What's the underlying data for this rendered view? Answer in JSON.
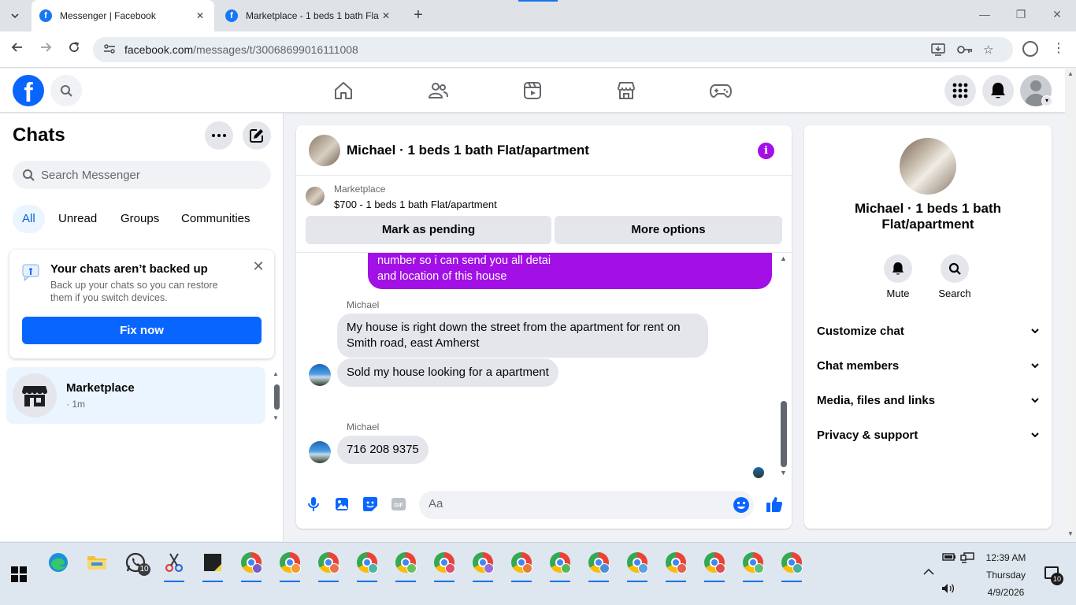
{
  "browser": {
    "tabs": [
      {
        "title": "Messenger | Facebook",
        "favicon": "facebook-icon",
        "active": true
      },
      {
        "title": "Marketplace - 1 beds 1 bath Fla",
        "favicon": "facebook-icon",
        "active": false
      }
    ],
    "url_host": "facebook.com",
    "url_path": "/messages/t/30068699016111008"
  },
  "header": {
    "nav": [
      "home-icon",
      "friends-icon",
      "video-icon",
      "marketplace-icon",
      "gaming-icon"
    ],
    "right": [
      "menu-grid-icon",
      "notifications-bell-icon",
      "account-avatar"
    ]
  },
  "sidebar": {
    "title": "Chats",
    "search_placeholder": "Search Messenger",
    "filters": [
      "All",
      "Unread",
      "Groups",
      "Communities"
    ],
    "backup": {
      "title": "Your chats aren’t backed up",
      "subtitle": "Back up your chats so you can restore them if you switch devices.",
      "button": "Fix now"
    },
    "chats": [
      {
        "name": "Marketplace",
        "meta": "· 1m"
      }
    ]
  },
  "conversation": {
    "title": "Michael · 1 beds 1 bath Flat/apartment",
    "marketplace_label": "Marketplace",
    "listing": "$700 - 1 beds 1 bath Flat/apartment",
    "buttons": {
      "pending": "Mark as pending",
      "more": "More options"
    },
    "outgoing_partial": [
      "number so i can send you all detai",
      "and location of this house"
    ],
    "groups": [
      {
        "sender": "Michael",
        "messages": [
          "My house is right down the street from the apartment for rent on Smith road, east Amherst",
          "Sold my house looking for a apartment"
        ]
      },
      {
        "sender": "Michael",
        "messages": [
          "716 208 9375"
        ]
      }
    ],
    "composer_placeholder": "Aa",
    "accent": "#a210e6"
  },
  "info_panel": {
    "name": "Michael · 1 beds 1 bath Flat/apartment",
    "actions": [
      {
        "label": "Mute",
        "icon": "bell-icon"
      },
      {
        "label": "Search",
        "icon": "search-icon"
      }
    ],
    "sections": [
      "Customize chat",
      "Chat members",
      "Media, files and links",
      "Privacy & support"
    ]
  },
  "taskbar": {
    "whatsapp_badge": "10",
    "time": "12:39 AM",
    "day": "Thursday",
    "date": "4/9/2026",
    "notifications_badge": "10"
  }
}
